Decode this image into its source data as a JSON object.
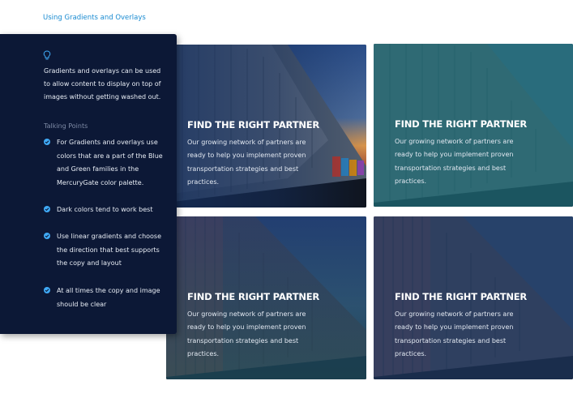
{
  "page": {
    "title": "Using Gradients and Overlays"
  },
  "sidebar": {
    "icon": "lightbulb-icon",
    "intro": "Gradients and overlays can be used to allow content to display on top of images without getting washed out.",
    "talking_points_heading": "Talking Points",
    "points": [
      "For Gradients and overlays use colors that are a part of the Blue and Green families in the MercuryGate color palette.",
      "Dark colors tend to work best",
      "Use linear gradients and choose the direction that best supports the copy and layout",
      "At all times the copy and image should be clear"
    ],
    "check_color": "#3fa9f5"
  },
  "cards": [
    {
      "title": "FIND THE RIGHT PARTNER",
      "body": "Our growing network of partners are ready to help you implement proven transportation strategies and best practices.",
      "overlay": "blue-gradient-left",
      "image": "train-container-photo"
    },
    {
      "title": "FIND THE RIGHT PARTNER",
      "body": "Our growing network of partners are ready to help you implement proven transportation strategies and best practices.",
      "overlay": "teal-solid",
      "image": "train-container-photo"
    },
    {
      "title": "FIND THE RIGHT PARTNER",
      "body": "Our growing network of partners are ready to help you implement proven transportation strategies and best practices.",
      "overlay": "blue-teal-vertical",
      "image": "train-container-photo"
    },
    {
      "title": "FIND THE RIGHT PARTNER",
      "body": "Our growing network of partners are ready to help you implement proven transportation strategies and best practices.",
      "overlay": "navy-solid",
      "image": "train-container-photo"
    }
  ],
  "colors": {
    "sidebar_bg": "#0c1836",
    "title_blue": "#1a8bd1",
    "teal_overlay": "#1f6b78",
    "navy_overlay": "#1e3a66"
  }
}
